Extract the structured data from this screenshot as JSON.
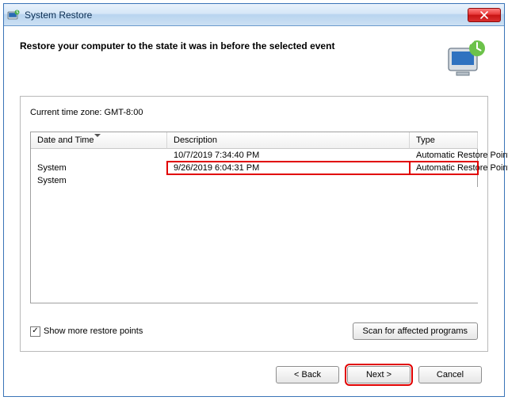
{
  "window": {
    "title": "System Restore"
  },
  "heading": "Restore your computer to the state it was in before the selected event",
  "timezone_label": "Current time zone: GMT-8:00",
  "columns": {
    "datetime": "Date and Time",
    "description": "Description",
    "type": "Type"
  },
  "rows": [
    {
      "datetime": "10/7/2019 7:34:40 PM",
      "description": "Automatic Restore Point",
      "type": "System"
    },
    {
      "datetime": "9/26/2019 6:04:31 PM",
      "description": "Automatic Restore Point",
      "type": "System"
    }
  ],
  "show_more_label": "Show more restore points",
  "scan_button": "Scan for affected programs",
  "buttons": {
    "back": "< Back",
    "next": "Next >",
    "cancel": "Cancel"
  }
}
